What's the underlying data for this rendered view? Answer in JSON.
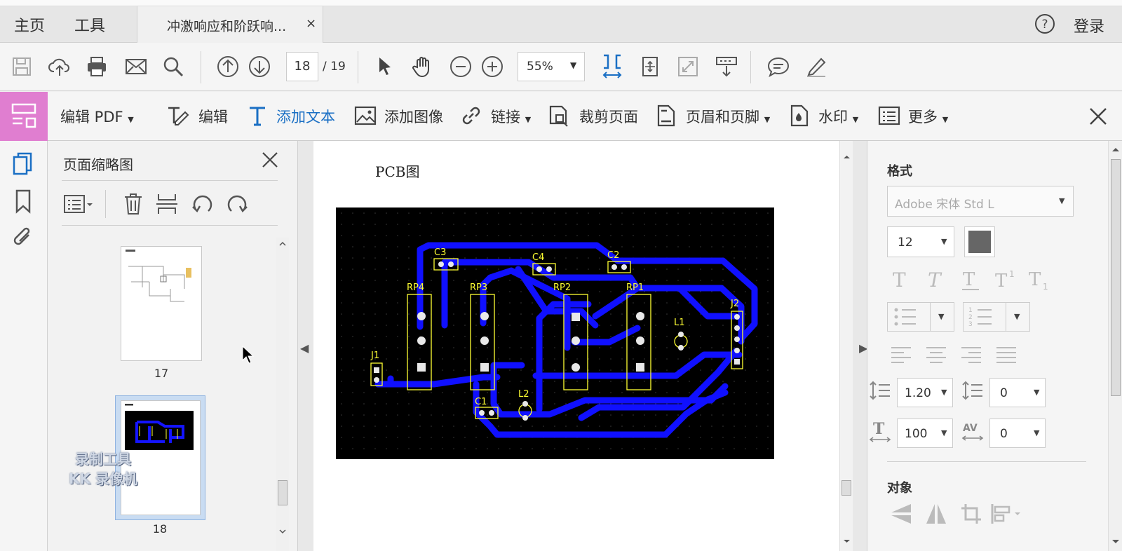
{
  "tabs": {
    "home": "主页",
    "tools": "工具",
    "document": "冲激响应和阶跃响...",
    "close": "×"
  },
  "header": {
    "login": "登录"
  },
  "toolbar": {
    "page_current": "18",
    "page_total": "/ 19",
    "zoom": "55%"
  },
  "edit_toolbar": {
    "mode": "编辑 PDF",
    "items": [
      {
        "label": "编辑"
      },
      {
        "label": "添加文本"
      },
      {
        "label": "添加图像"
      },
      {
        "label": "链接"
      },
      {
        "label": "裁剪页面"
      },
      {
        "label": "页眉和页脚"
      },
      {
        "label": "水印"
      },
      {
        "label": "更多"
      }
    ]
  },
  "thumbnails": {
    "title": "页面缩略图",
    "pages": [
      {
        "label": "17"
      },
      {
        "label": "18"
      }
    ]
  },
  "watermark": {
    "line1": "录制工具",
    "line2": "KK 录像机"
  },
  "document": {
    "heading": "PCB图",
    "pcb_labels": {
      "c3": "C3",
      "c4": "C4",
      "c2": "C2",
      "rp4": "RP4",
      "rp3": "RP3",
      "rp2": "RP2",
      "rp1": "RP1",
      "j2": "J2",
      "l1": "L1",
      "j1": "J1",
      "l2": "L2",
      "c1": "C1"
    }
  },
  "format_panel": {
    "title": "格式",
    "font": "Adobe 宋体 Std L",
    "font_size": "12",
    "line_spacing": "1.20",
    "para_spacing": "0",
    "scale": "100",
    "char_spacing": "0",
    "objects_title": "对象"
  },
  "colors": {
    "accent_blue": "#1a6fc4",
    "edit_badge": "#e07ed0",
    "pcb_trace": "#1010ff",
    "pcb_silk": "#ffff33"
  }
}
